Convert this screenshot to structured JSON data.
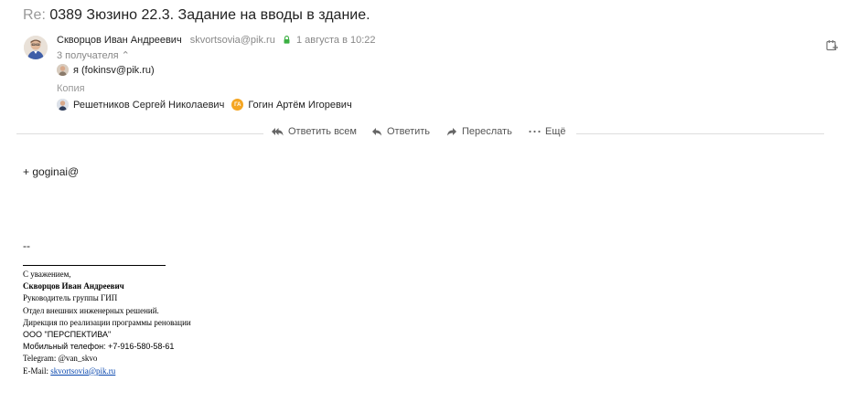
{
  "subject": {
    "prefix": "Re:",
    "text": "0389 Зюзино 22.3. Задание на вводы в здание."
  },
  "sender": {
    "name": "Скворцов Иван Андреевич",
    "email": "skvortsovia@pik.ru",
    "date": "1 августа в 10:22"
  },
  "recipients_toggle": "3 получателя ⌃",
  "to": [
    {
      "label": "я (fokinsv@pik.ru)"
    }
  ],
  "cc_label": "Копия",
  "cc": [
    {
      "name": "Решетников Сергей Николаевич"
    },
    {
      "name": "Гогин Артём Игоревич",
      "initials": "ГА"
    }
  ],
  "actions": {
    "reply_all": "Ответить всем",
    "reply": "Ответить",
    "forward": "Переслать",
    "more": "Ещё"
  },
  "body": {
    "text": "+ goginai@",
    "dashes": "--"
  },
  "signature": {
    "greeting": "С уважением,",
    "name": "Скворцов Иван Андреевич",
    "position": "Руководитель группы ГИП",
    "department": "Отдел внешних инженерных решений.",
    "directorate": "Дирекция по реализации программы реновации",
    "company": "ООО \"ПЕРСПЕКТИВА\"",
    "mobile": "Мобильный телефон: +7-916-580-58-61",
    "telegram": "Telegram: @van_skvo",
    "email_label": "E-Mail: ",
    "email": "skvortsovia@pik.ru"
  },
  "colors": {
    "accent_green": "#3cb043",
    "ga_badge": "#f5a623",
    "link": "#0645ad"
  }
}
